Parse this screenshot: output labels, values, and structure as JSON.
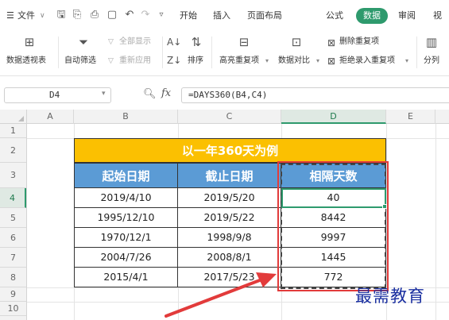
{
  "menubar": {
    "menu_icon": "☰",
    "file_label": "文件",
    "tabs": [
      "开始",
      "插入",
      "页面布局",
      "公式",
      "数据",
      "审阅",
      "视"
    ]
  },
  "ribbon": {
    "pivot_label": "数据透视表",
    "autofilter_label": "自动筛选",
    "show_all_label": "全部显示",
    "reapply_label": "重新应用",
    "sort_label": "排序",
    "highlight_dup_label": "高亮重复项",
    "compare_label": "数据对比",
    "remove_dup_label": "删除重复项",
    "reject_dup_label": "拒绝录入重复项",
    "split_label": "分列"
  },
  "formula_bar": {
    "name_box": "D4",
    "fx": "fx",
    "formula": "=DAYS360(B4,C4)"
  },
  "grid": {
    "columns": [
      "A",
      "B",
      "C",
      "D",
      "E"
    ],
    "rows": [
      "1",
      "2",
      "3",
      "4",
      "5",
      "6",
      "7",
      "8",
      "9",
      "10"
    ]
  },
  "table": {
    "title": "以一年360天为例",
    "headers": [
      "起始日期",
      "截止日期",
      "相隔天数"
    ],
    "rows": [
      [
        "2019/4/10",
        "2019/5/20",
        "40"
      ],
      [
        "1995/12/10",
        "2019/5/22",
        "8442"
      ],
      [
        "1970/12/1",
        "1998/9/8",
        "9997"
      ],
      [
        "2004/7/26",
        "2008/8/1",
        "1445"
      ],
      [
        "2015/4/1",
        "2017/5/23",
        "772"
      ]
    ]
  },
  "watermark": "最需教育",
  "colors": {
    "title_fill": "#fbc001",
    "header_fill": "#5b9bd5",
    "accent_green": "#2e9a6d",
    "highlight_red": "#e23b3b"
  },
  "icons": {
    "pivot": "pivot-table-icon",
    "filter": "funnel-icon",
    "sort": "sort-icon",
    "zoom": "zoom-icon"
  }
}
